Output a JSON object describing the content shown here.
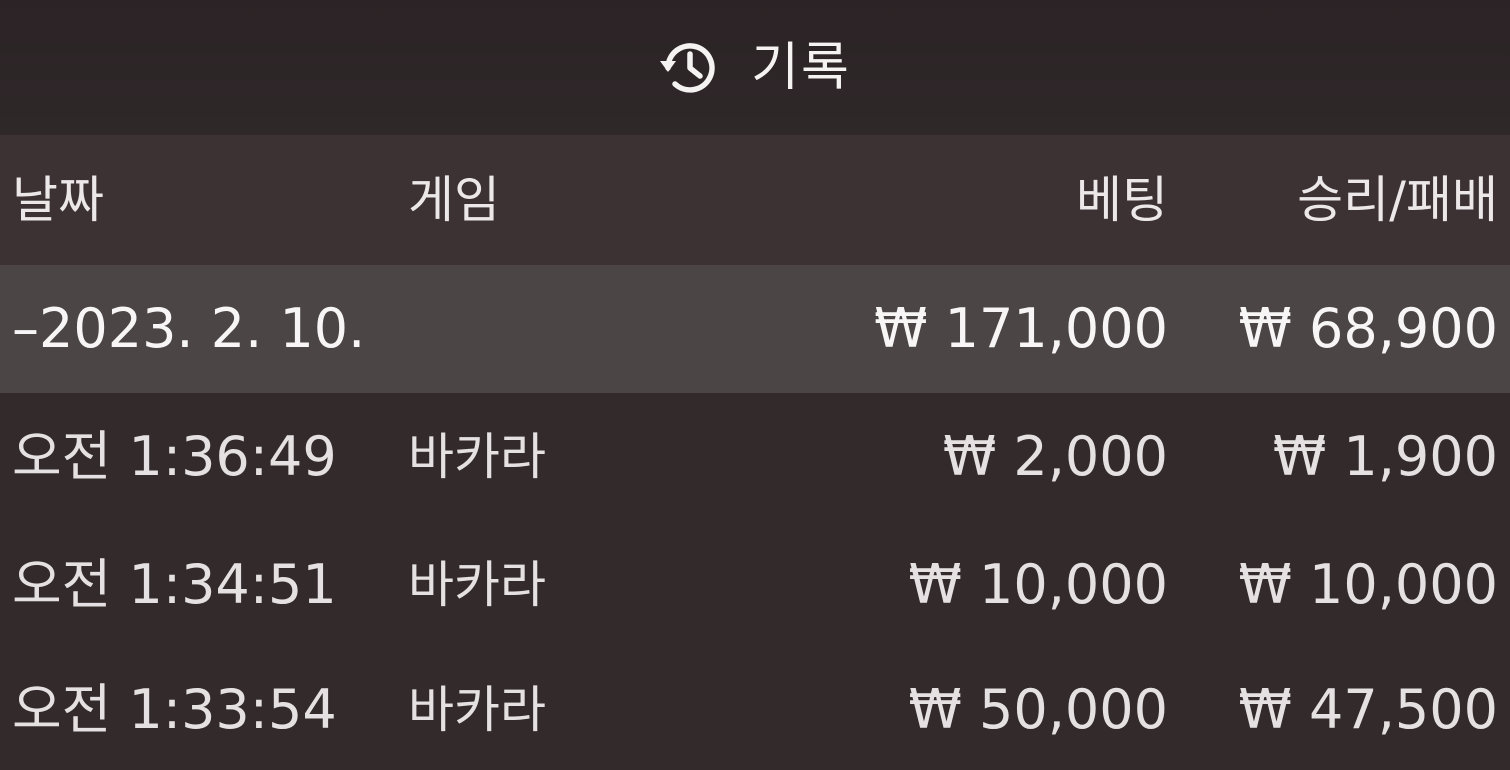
{
  "header": {
    "icon": "history-icon",
    "title": "기록"
  },
  "columns": {
    "date": "날짜",
    "game": "게임",
    "bet": "베팅",
    "result": "승리/패배"
  },
  "summary": {
    "date": "–2023. 2. 10.",
    "bet": "₩ 171,000",
    "result": "₩ 68,900"
  },
  "rows": [
    {
      "time": "오전 1:36:49",
      "game": "바카라",
      "bet": "₩ 2,000",
      "result": "₩ 1,900"
    },
    {
      "time": "오전 1:34:51",
      "game": "바카라",
      "bet": "₩ 10,000",
      "result": "₩ 10,000"
    },
    {
      "time": "오전 1:33:54",
      "game": "바카라",
      "bet": "₩ 50,000",
      "result": "₩ 47,500"
    }
  ],
  "colors": {
    "background": "#2e2627",
    "header_row": "#3c3234",
    "summary_row": "#4b4546",
    "text": "#f2eeee"
  }
}
